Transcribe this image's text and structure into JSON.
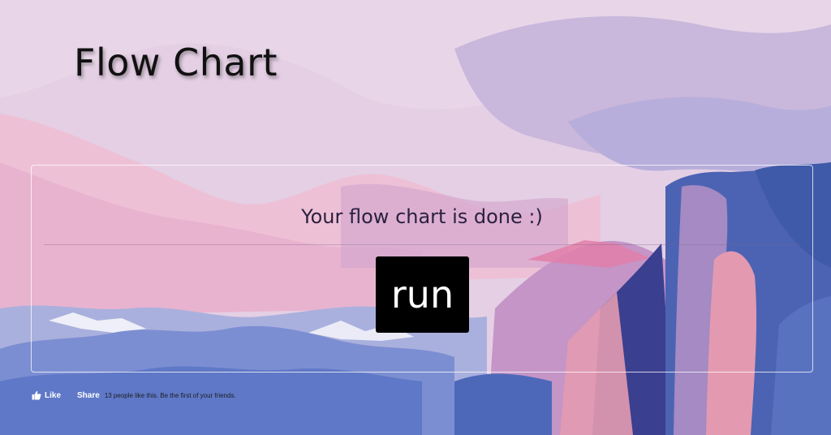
{
  "header": {
    "title": "Flow Chart"
  },
  "card": {
    "message": "Your flow chart is done :)",
    "run_label": "run"
  },
  "facebook": {
    "like_label": "Like",
    "share_label": "Share",
    "social_text": "13 people like this. Be the first of your friends.",
    "like_icon": "thumbs-up-icon"
  },
  "background": {
    "description_icon": "mountain-landscape-illustration",
    "colors": {
      "sky_light": "#e6d1e6",
      "sky_pink": "#efc2d8",
      "lavender": "#b8aedb",
      "mountain_blue": "#4c63b3",
      "deep_blue": "#3b3f8f",
      "pink_rock": "#e39ab0"
    }
  }
}
